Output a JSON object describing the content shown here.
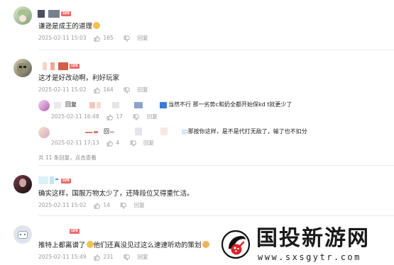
{
  "comments": [
    {
      "text": "谦逊是成王的道理",
      "level": "LV6",
      "time": "2025-02-11 15:03",
      "likes": "165",
      "reply": "回复",
      "avatar_colors": [
        "#c9d9b8",
        "#6f8f6a"
      ],
      "name_colors": [
        "#4a5060",
        "#7a7f8c"
      ]
    },
    {
      "text": "这才是好改动啊，利好玩家",
      "level": "LV6",
      "time": "2025-02-11 15:02",
      "likes": "164",
      "reply": "回复",
      "avatar_colors": [
        "#b9b39a",
        "#5b5a4a"
      ],
      "name_colors": [
        "#f6d3c8",
        "#d06048"
      ]
    },
    {
      "text": "确实这样，国服万物太少了，还降段位又得重忙活。",
      "level": "LV6",
      "time": "2025-02-11 15:02",
      "likes": "14",
      "reply": "回复",
      "avatar_colors": [
        "#5a2a34",
        "#1d1418"
      ],
      "name_colors": [
        "#d8f2f7",
        "#a8cfe8"
      ]
    },
    {
      "text": "推特上都离谱了",
      "text_tail": "他们还真没见过这么速速听劝的策划",
      "level": "LV6",
      "time": "2025-02-11 15:49",
      "likes": "231",
      "reply": "回复",
      "avatar_colors": [
        "#d8dce6",
        "#8e98b0"
      ],
      "name_colors": [
        "#f0f0f0",
        "#e3a8a8"
      ]
    }
  ],
  "replies": [
    {
      "reply_word": "回复",
      "text": "当然不行 那一劣势c和奶全都开始保kd t就更少了",
      "time": "2025-02-11 16:48",
      "likes": "17",
      "reply": "回复"
    },
    {
      "reply_word": "回",
      "text": ":那按你这样，是不是代打无敌了，输了也不扣分",
      "time": "2025-02-11 17:13",
      "likes": "4",
      "reply": "回复"
    }
  ],
  "more_replies": "共 11 条回复，点击查看",
  "watermark": {
    "title": "国投新游网",
    "url": "www.sxsgytr.com",
    "color": "#1a1a1a"
  }
}
